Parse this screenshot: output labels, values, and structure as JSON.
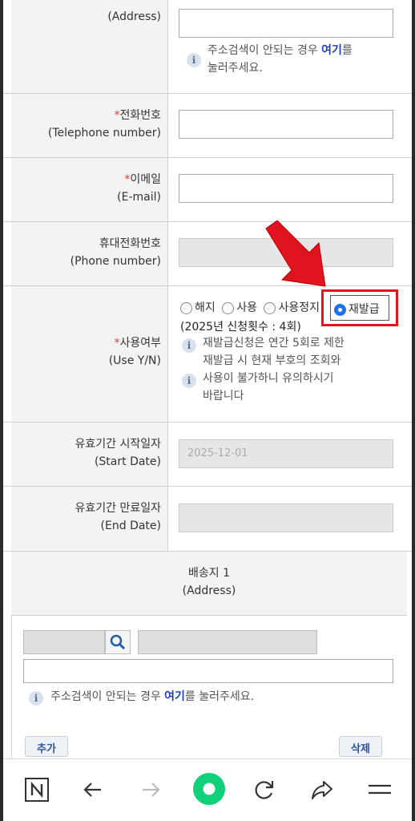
{
  "address_row": {
    "label_ko": "",
    "label_en": "(Address)",
    "info_pre": "주소검색이 안되는 경우 ",
    "info_link": "여기",
    "info_post": "를",
    "info_line2": "눌러주세요."
  },
  "telephone_row": {
    "req": "*",
    "label_ko": "전화번호",
    "label_en": "(Telephone number)"
  },
  "email_row": {
    "req": "*",
    "label_ko": "이메일",
    "label_en": "(E-mail)"
  },
  "phone_row": {
    "label_ko": "휴대전화번호",
    "label_en": "(Phone number)"
  },
  "use_row": {
    "req": "*",
    "label_ko": "사용여부",
    "label_en": "(Use Y/N)",
    "options": [
      {
        "label": "해지",
        "selected": false
      },
      {
        "label": "사용",
        "selected": false
      },
      {
        "label": "사용정지",
        "selected": false
      },
      {
        "label": "재발급",
        "selected": true
      }
    ],
    "count_text": "(2025년 신청횟수 : 4회)",
    "info1_line1": "재발급신청은 연간 5회로 제한",
    "info1_line2": "재발급 시 현재 부호의 조회와",
    "info2_line1": "사용이 불가하니 유의하시기",
    "info2_line2": "바랍니다"
  },
  "start_row": {
    "label_ko": "유효기간 시작일자",
    "label_en": "(Start Date)",
    "value": "2025-12-01"
  },
  "end_row": {
    "label_ko": "유효기간 만료일자",
    "label_en": "(End Date)",
    "value": ""
  },
  "shipping": {
    "title": "배송지 1",
    "subtitle": "(Address)",
    "info_pre": "주소검색이 안되는 경우 ",
    "info_link": "여기",
    "info_post": "를 눌러주세요.",
    "add_label": "추가",
    "delete_label": "삭제"
  },
  "info_icon_glyph": "i",
  "colors": {
    "accent": "#1a73e8",
    "required": "#e23b3b",
    "link": "#1f3dbf",
    "highlight": "#e0141e",
    "nav_green": "#10d07a"
  }
}
